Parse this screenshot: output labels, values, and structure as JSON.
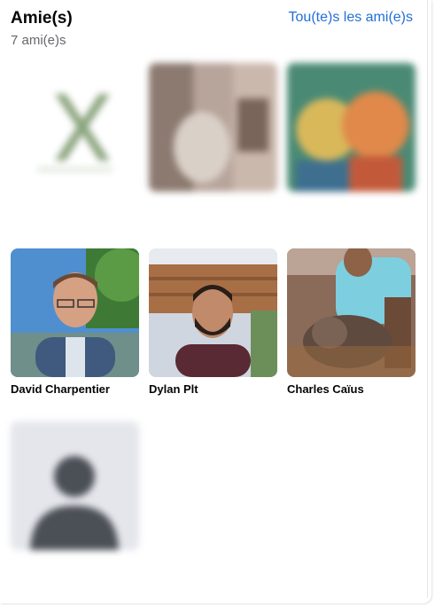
{
  "header": {
    "title": "Amie(s)",
    "count": "7 ami(e)s",
    "see_all": "Tou(te)s les ami(e)s"
  },
  "friends": [
    {
      "name": "",
      "subname": "",
      "avatar": "x-logo-icon",
      "blurred": true
    },
    {
      "name": "",
      "subname": "",
      "avatar": "room-photo",
      "blurred": true
    },
    {
      "name": "",
      "subname": "",
      "avatar": "painting-faces",
      "blurred": true
    },
    {
      "name": "David Charpentier",
      "subname": "",
      "avatar": "man-glasses-photo",
      "blurred": false
    },
    {
      "name": "Dylan Plt",
      "subname": "",
      "avatar": "man-selfie-photo",
      "blurred": false
    },
    {
      "name": "Charles Caïus",
      "subname": "",
      "avatar": "man-with-dog-photo",
      "blurred": false
    },
    {
      "name": "",
      "subname": "",
      "avatar": "default-avatar-icon",
      "blurred": true
    }
  ],
  "colors": {
    "link": "#216fdb",
    "muted": "#65676b",
    "default_avatar_bg": "#e4e6eb",
    "default_avatar_fg": "#4b4f56"
  }
}
